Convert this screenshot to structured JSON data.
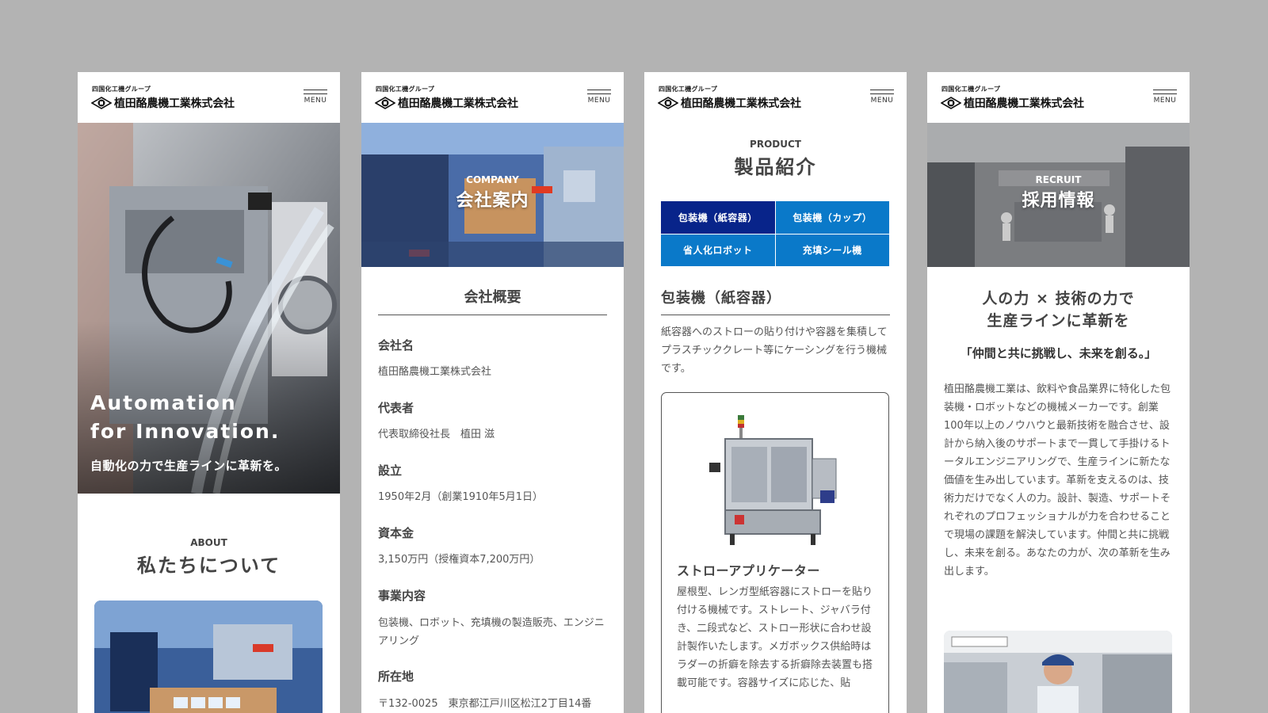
{
  "brand": {
    "group": "四国化工機グループ",
    "name": "植田酪農機工業株式会社",
    "menu_label": "MENU"
  },
  "colors": {
    "background": "#b3b3b3",
    "tab_active": "#08248a",
    "tab": "#0a79c9",
    "text": "#444444"
  },
  "top": {
    "hero_en_line1": "Automation",
    "hero_en_line2": "for Innovation.",
    "hero_jp": "自動化の力で生産ラインに革新を。",
    "about_en": "ABOUT",
    "about_jp": "私たちについて"
  },
  "company": {
    "hero_en": "COMPANY",
    "hero_jp": "会社案内",
    "overview_title": "会社概要",
    "rows": [
      {
        "term": "会社名",
        "value": "植田酪農機工業株式会社"
      },
      {
        "term": "代表者",
        "value": "代表取締役社長　植田 滋"
      },
      {
        "term": "設立",
        "value": "1950年2月（創業1910年5月1日）"
      },
      {
        "term": "資本金",
        "value": "3,150万円（授権資本7,200万円）"
      },
      {
        "term": "事業内容",
        "value": "包装機、ロボット、充填機の製造販売、エンジニアリング"
      },
      {
        "term": "所在地",
        "value": "〒132-0025　東京都江戸川区松江2丁目14番"
      }
    ]
  },
  "product": {
    "en": "PRODUCT",
    "jp": "製品紹介",
    "tabs": [
      "包装機（紙容器）",
      "包装機（カップ）",
      "省人化ロボット",
      "充填シール機"
    ],
    "category_title": "包装機（紙容器）",
    "category_desc": "紙容器へのストローの貼り付けや容器を集積してプラスチッククレート等にケーシングを行う機械です。",
    "card_title": "ストローアプリケーター",
    "card_desc": "屋根型、レンガ型紙容器にストローを貼り付ける機械です。ストレート、ジャバラ付き、二段式など、ストロー形状に合わせ設計製作いたします。メガボックス供給時はラダーの折癖を除去する折癖除去装置も搭載可能です。容器サイズに応じた、貼"
  },
  "recruit": {
    "hero_en": "RECRUIT",
    "hero_jp": "採用情報",
    "headline_line1": "人の力 × 技術の力で",
    "headline_line2": "生産ラインに革新を",
    "sub": "「仲間と共に挑戦し、未来を創る。」",
    "body": "植田酪農機工業は、飲料や食品業界に特化した包装機・ロボットなどの機械メーカーです。創業100年以上のノウハウと最新技術を融合させ、設計から納入後のサポートまで一貫して手掛けるトータルエンジニアリングで、生産ラインに新たな価値を生み出しています。革新を支えるのは、技術力だけでなく人の力。設計、製造、サポートそれぞれのプロフェッショナルが力を合わせることで現場の課題を解決しています。仲間と共に挑戦し、未来を創る。あなたの力が、次の革新を生み出します。"
  }
}
